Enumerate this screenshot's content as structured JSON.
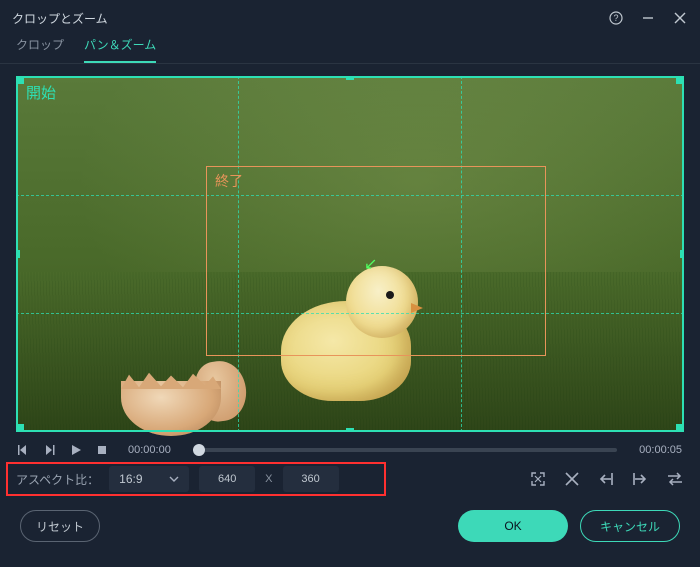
{
  "window": {
    "title": "クロップとズーム"
  },
  "tabs": {
    "crop": "クロップ",
    "panzoom": "パン＆ズーム"
  },
  "canvas": {
    "start_label": "開始",
    "end_label": "終了"
  },
  "playback": {
    "time_current": "00:00:00",
    "time_total": "00:00:05"
  },
  "aspect": {
    "label": "アスペクト比：",
    "ratio_value": "16:9",
    "width": "640",
    "x": "X",
    "height": "360"
  },
  "buttons": {
    "reset": "リセット",
    "ok": "OK",
    "cancel": "キャンセル"
  }
}
